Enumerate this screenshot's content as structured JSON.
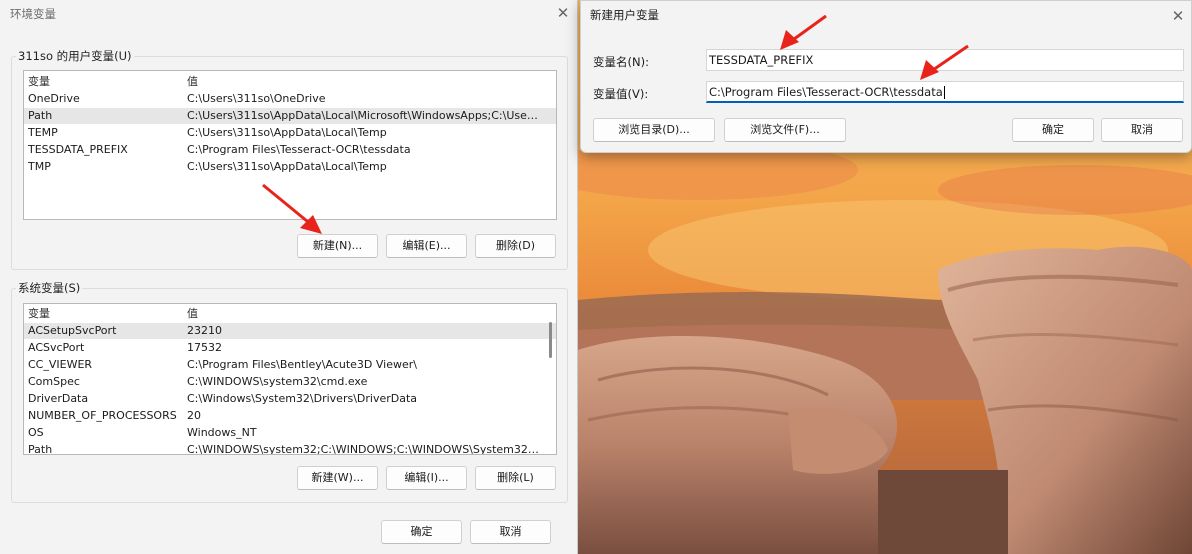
{
  "env_window": {
    "title": "环境变量",
    "user_group_label": "311so 的用户变量(U)",
    "system_group_label": "系统变量(S)",
    "col_var": "变量",
    "col_val": "值",
    "user_vars": [
      {
        "name": "OneDrive",
        "value": "C:\\Users\\311so\\OneDrive"
      },
      {
        "name": "Path",
        "value": "C:\\Users\\311so\\AppData\\Local\\Microsoft\\WindowsApps;C:\\Users\\..."
      },
      {
        "name": "TEMP",
        "value": "C:\\Users\\311so\\AppData\\Local\\Temp"
      },
      {
        "name": "TESSDATA_PREFIX",
        "value": "C:\\Program Files\\Tesseract-OCR\\tessdata"
      },
      {
        "name": "TMP",
        "value": "C:\\Users\\311so\\AppData\\Local\\Temp"
      }
    ],
    "user_buttons": {
      "new": "新建(N)...",
      "edit": "编辑(E)...",
      "delete": "删除(D)"
    },
    "system_vars": [
      {
        "name": "ACSetupSvcPort",
        "value": "23210"
      },
      {
        "name": "ACSvcPort",
        "value": "17532"
      },
      {
        "name": "CC_VIEWER",
        "value": "C:\\Program Files\\Bentley\\Acute3D Viewer\\"
      },
      {
        "name": "ComSpec",
        "value": "C:\\WINDOWS\\system32\\cmd.exe"
      },
      {
        "name": "DriverData",
        "value": "C:\\Windows\\System32\\Drivers\\DriverData"
      },
      {
        "name": "NUMBER_OF_PROCESSORS",
        "value": "20"
      },
      {
        "name": "OS",
        "value": "Windows_NT"
      },
      {
        "name": "Path",
        "value": "C:\\WINDOWS\\system32;C:\\WINDOWS;C:\\WINDOWS\\System32\\W..."
      }
    ],
    "system_buttons": {
      "new": "新建(W)...",
      "edit": "编辑(I)...",
      "delete": "删除(L)"
    },
    "ok": "确定",
    "cancel": "取消"
  },
  "new_var_dialog": {
    "title": "新建用户变量",
    "name_label": "变量名(N):",
    "name_value": "TESSDATA_PREFIX",
    "value_label": "变量值(V):",
    "value_value": "C:\\Program Files\\Tesseract-OCR\\tessdata",
    "browse_dir": "浏览目录(D)...",
    "browse_file": "浏览文件(F)...",
    "ok": "确定",
    "cancel": "取消"
  },
  "icons": {
    "close": "close-icon",
    "annotation": "red-arrow"
  },
  "colors": {
    "accent": "#005fb8",
    "arrow": "#e8231c",
    "window_bg": "#f3f3f3"
  }
}
